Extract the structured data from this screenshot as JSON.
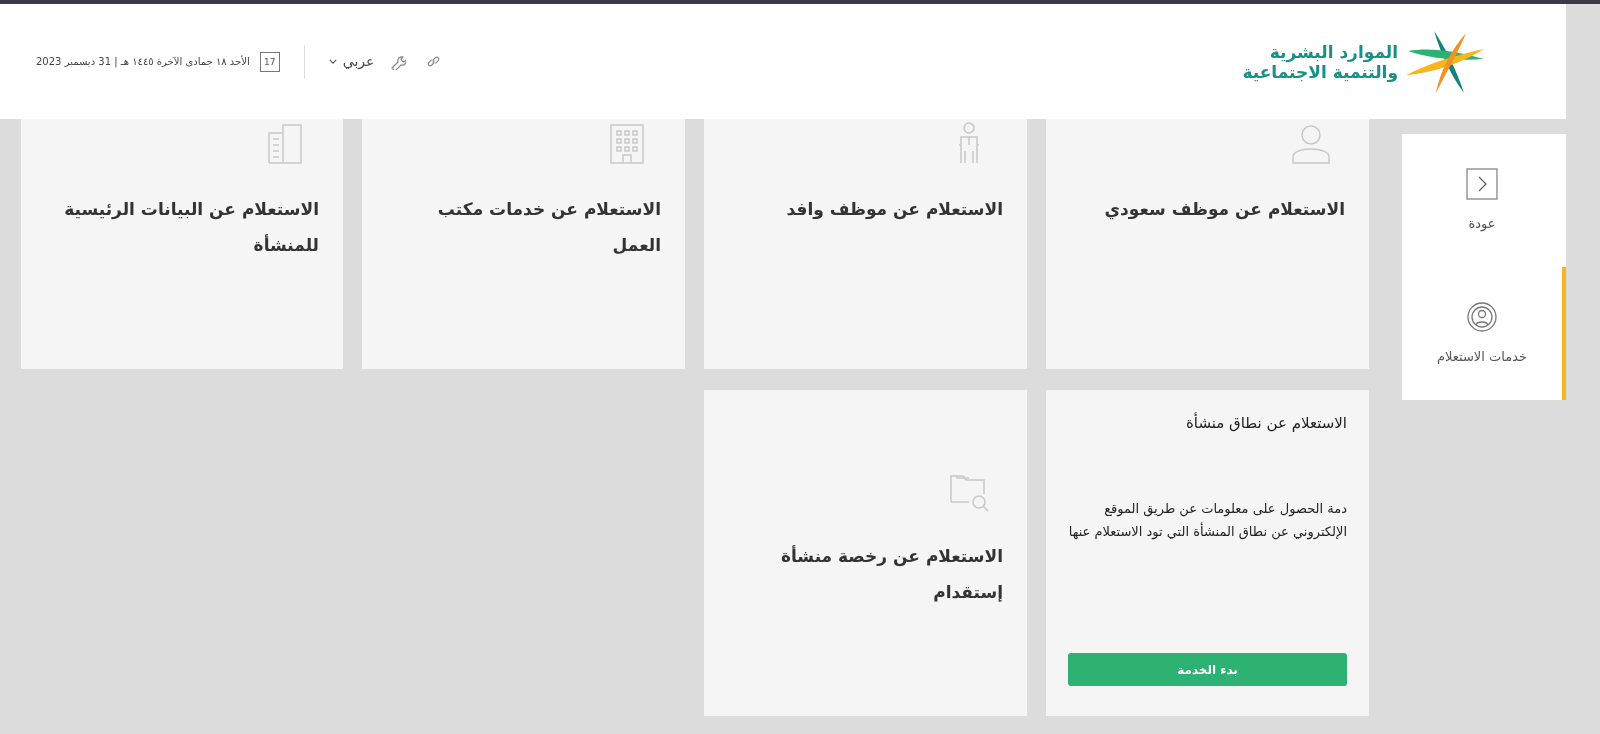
{
  "header": {
    "logo": {
      "lines": [
        "الموارد البشرية",
        "والتنمية الاجتماعية"
      ]
    },
    "language": "عربي",
    "date": "الأحد ١٨ جمادى الآخرة ١٤٤٥ هـ | 31 ديسمبر 2023",
    "calendar_day": "17"
  },
  "sidebar": {
    "items": [
      {
        "label": "عودة",
        "selected": false
      },
      {
        "label": "خدمات الاستعلام",
        "selected": true
      }
    ]
  },
  "cards": [
    {
      "kind": "tile",
      "title": "الاستعلام عن موظف سعودي"
    },
    {
      "kind": "tile",
      "title": "الاستعلام عن موظف وافد"
    },
    {
      "kind": "tile",
      "title": "الاستعلام عن خدمات مكتب العمل"
    },
    {
      "kind": "tile",
      "title": "الاستعلام عن البيانات الرئيسية للمنشأة"
    },
    {
      "kind": "detail",
      "title": "الاستعلام عن نطاق منشأة",
      "description": "دمة الحصول على معلومات عن طريق الموقع الإلكتروني عن نطاق المنشأة التي تود الاستعلام عنها",
      "button": "بدء الخدمة"
    },
    {
      "kind": "tile",
      "title": "الاستعلام عن رخصة منشأة إستقدام"
    }
  ]
}
